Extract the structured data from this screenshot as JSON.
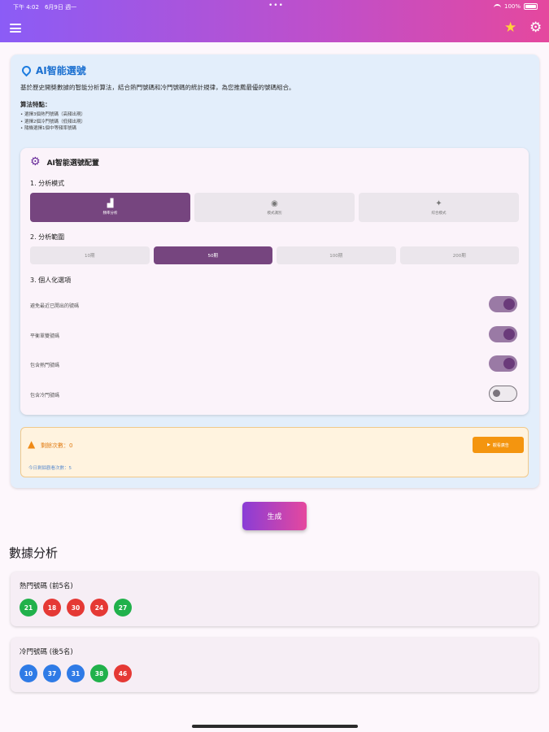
{
  "status_bar": {
    "time": "下午 4:02　6月9日 週一",
    "dots": "•••",
    "battery": "100%"
  },
  "appbar": {
    "menu_icon": "menu-icon",
    "favorite_icon": "star-icon",
    "settings_icon": "gear-icon",
    "colors": {
      "start": "#8b5cf6",
      "end": "#e5489e"
    }
  },
  "ai_card": {
    "title": "AI智能選號",
    "description": "基於歷史開獎數據的智能分析算法，結合熱門號碼和冷門號碼的統計規律，為您推薦最優的號碼組合。",
    "algo_title": "算法特點：",
    "algo_points": [
      "• 選擇3個熱門號碼（高頻出現）",
      "• 選擇2個冷門號碼（低頻出現）",
      "• 隨機選擇1個中等頻率號碼"
    ]
  },
  "config": {
    "title": "AI智能選號配置",
    "section1": "1. 分析模式",
    "modes": [
      {
        "label": "頻率分析",
        "icon": "bar-chart-icon",
        "selected": true
      },
      {
        "label": "模式識別",
        "icon": "bulb-icon",
        "selected": false
      },
      {
        "label": "綜合模式",
        "icon": "sparkle-icon",
        "selected": false
      }
    ],
    "section2": "2. 分析範圍",
    "ranges": [
      {
        "label": "10期",
        "selected": false
      },
      {
        "label": "50期",
        "selected": true
      },
      {
        "label": "100期",
        "selected": false
      },
      {
        "label": "200期",
        "selected": false
      }
    ],
    "section3": "3. 個人化選項",
    "options": [
      {
        "label": "避免最近已開出的號碼",
        "on": true
      },
      {
        "label": "平衡單雙號碼",
        "on": true
      },
      {
        "label": "包含熱門號碼",
        "on": true
      },
      {
        "label": "包含冷門號碼",
        "on": false
      }
    ]
  },
  "warning": {
    "remaining": "剩餘次數：0",
    "button": "觀看廣告",
    "daily": "今日剩餘觀看次數：5",
    "color": "#f4950f"
  },
  "generate_button": "生成",
  "analysis": {
    "title": "數據分析",
    "hot": {
      "label": "熱門號碼 (前5名)",
      "numbers": [
        {
          "n": "21",
          "color": "#21b14b"
        },
        {
          "n": "18",
          "color": "#e53935"
        },
        {
          "n": "30",
          "color": "#e53935"
        },
        {
          "n": "24",
          "color": "#e53935"
        },
        {
          "n": "27",
          "color": "#21b14b"
        }
      ]
    },
    "cold": {
      "label": "冷門號碼 (後5名)",
      "numbers": [
        {
          "n": "10",
          "color": "#2f7be6"
        },
        {
          "n": "37",
          "color": "#2f7be6"
        },
        {
          "n": "31",
          "color": "#2f7be6"
        },
        {
          "n": "38",
          "color": "#21b14b"
        },
        {
          "n": "46",
          "color": "#e53935"
        }
      ]
    }
  }
}
